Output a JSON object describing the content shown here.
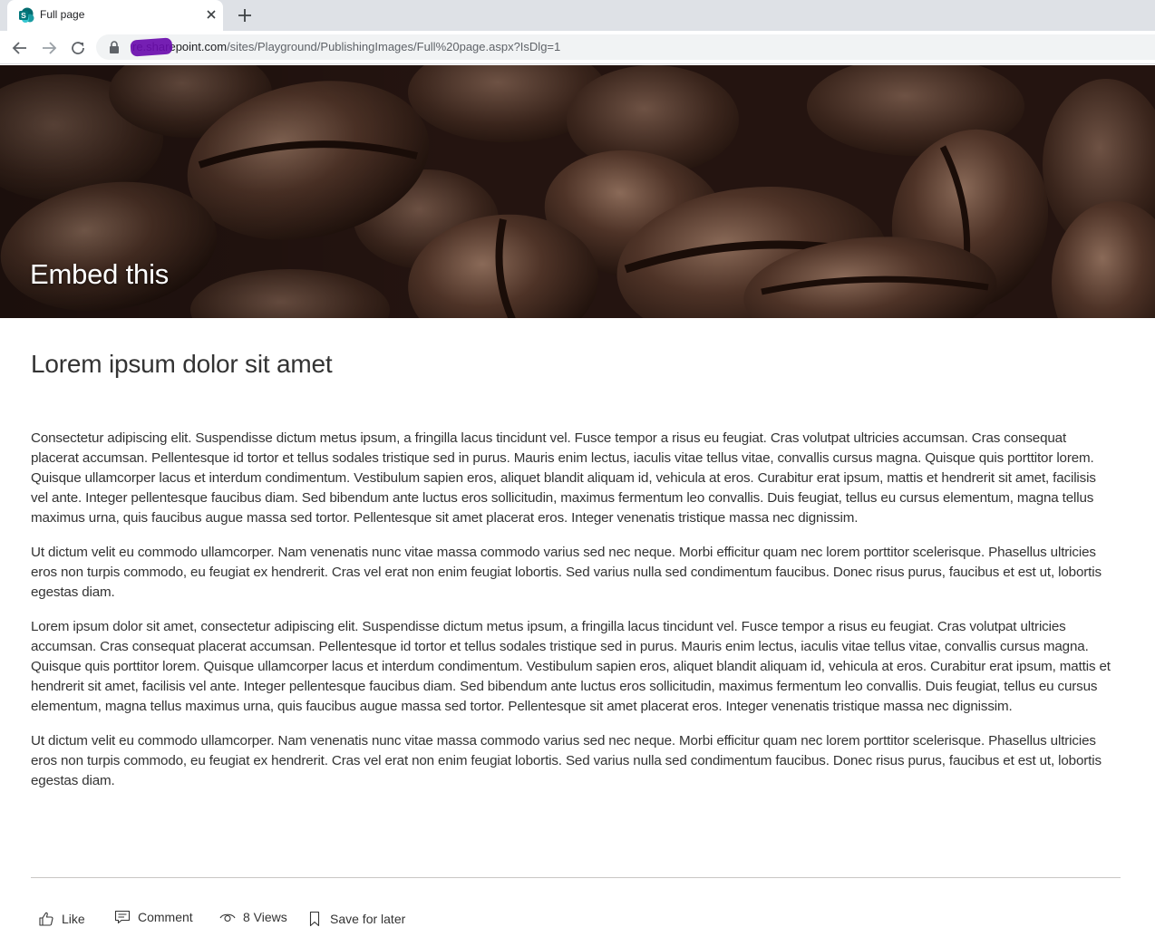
{
  "browser": {
    "tab_title": "Full page",
    "url_host": "re.sharepoint.com",
    "url_path": "/sites/Playground/PublishingImages/Full%20page.aspx?IsDlg=1",
    "favicon_color": "#038387"
  },
  "hero": {
    "title": "Embed this"
  },
  "page": {
    "heading": "Lorem ipsum dolor sit amet",
    "paragraphs": [
      "Consectetur adipiscing elit. Suspendisse dictum metus ipsum, a fringilla lacus tincidunt vel. Fusce tempor a risus eu feugiat. Cras volutpat ultricies accumsan. Cras consequat placerat accumsan. Pellentesque id tortor et tellus sodales tristique sed in purus. Mauris enim lectus, iaculis vitae tellus vitae, convallis cursus magna. Quisque quis porttitor lorem. Quisque ullamcorper lacus et interdum condimentum. Vestibulum sapien eros, aliquet blandit aliquam id, vehicula at eros. Curabitur erat ipsum, mattis et hendrerit sit amet, facilisis vel ante. Integer pellentesque faucibus diam. Sed bibendum ante luctus eros sollicitudin, maximus fermentum leo convallis. Duis feugiat, tellus eu cursus elementum, magna tellus maximus urna, quis faucibus augue massa sed tortor. Pellentesque sit amet placerat eros. Integer venenatis tristique massa nec dignissim.",
      "Ut dictum velit eu commodo ullamcorper. Nam venenatis nunc vitae massa commodo varius sed nec neque. Morbi efficitur quam nec lorem porttitor scelerisque. Phasellus ultricies eros non turpis commodo, eu feugiat ex hendrerit. Cras vel erat non enim feugiat lobortis. Sed varius nulla sed condimentum faucibus. Donec risus purus, faucibus et est ut, lobortis egestas diam.",
      "Lorem ipsum dolor sit amet, consectetur adipiscing elit. Suspendisse dictum metus ipsum, a fringilla lacus tincidunt vel. Fusce tempor a risus eu feugiat. Cras volutpat ultricies accumsan. Cras consequat placerat accumsan. Pellentesque id tortor et tellus sodales tristique sed in purus. Mauris enim lectus, iaculis vitae tellus vitae, convallis cursus magna. Quisque quis porttitor lorem. Quisque ullamcorper lacus et interdum condimentum. Vestibulum sapien eros, aliquet blandit aliquam id, vehicula at eros. Curabitur erat ipsum, mattis et hendrerit sit amet, facilisis vel ante. Integer pellentesque faucibus diam. Sed bibendum ante luctus eros sollicitudin, maximus fermentum leo convallis. Duis feugiat, tellus eu cursus elementum, magna tellus maximus urna, quis faucibus augue massa sed tortor. Pellentesque sit amet placerat eros. Integer venenatis tristique massa nec dignissim.",
      "Ut dictum velit eu commodo ullamcorper. Nam venenatis nunc vitae massa commodo varius sed nec neque. Morbi efficitur quam nec lorem porttitor scelerisque. Phasellus ultricies eros non turpis commodo, eu feugiat ex hendrerit. Cras vel erat non enim feugiat lobortis. Sed varius nulla sed condimentum faucibus. Donec risus purus, faucibus et est ut, lobortis egestas diam."
    ]
  },
  "social": {
    "like_label": "Like",
    "comment_label": "Comment",
    "views_label": "8 Views",
    "save_label": "Save for later"
  }
}
